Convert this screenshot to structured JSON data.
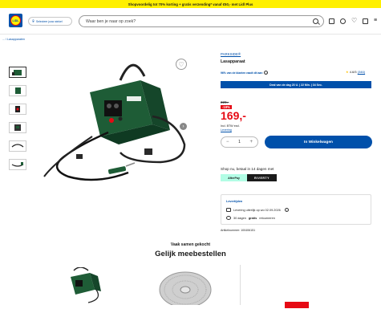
{
  "promo_banner": "Shopvoordelig tot 70% korting + gratis verzending* vanaf €50,- met Lidl Plus",
  "header": {
    "logo_text": "LIDL",
    "store_button": "Selecteer jouw winkel",
    "search_placeholder": "Waar ben je naar op zoek?"
  },
  "breadcrumb": "... / Lasapparaten",
  "gallery": {
    "thumb_count": 6
  },
  "product": {
    "brand": "PARKSIDE®",
    "title": "Lasapparaat",
    "recommend": "96% van de klanten raadt dit aan",
    "rating": "4.6/5",
    "reviews": "(346)",
    "deal_banner": "Deal van de dag 23 U. | 22 Min. | 34 Sec.",
    "old_price": "229,-",
    "discount": "-19%",
    "price": "169,-",
    "btw": "Incl. BTW excl.",
    "delivery_link": "Levering",
    "quantity": "1",
    "cart_button": "In Winkelwagen"
  },
  "payment": {
    "title": "Shop nu, betaal in 14 dagen met",
    "option1": "AfterPay",
    "option2": "RIVERTY"
  },
  "delivery": {
    "title": "Levertijden",
    "row1": "Levering uiterlijk op wo 02.09.2026",
    "row2_prefix": "30 dagen",
    "row2_bold": "gratis",
    "row2_suffix": "retourneren"
  },
  "article_number": "Artikelnummer: 100406151",
  "recommendations": {
    "subtitle": "Vaak samen gekocht",
    "title": "Gelijk meebestellen"
  },
  "colors": {
    "brand_blue": "#0050aa",
    "brand_yellow": "#fff000",
    "price_red": "#e60a14"
  }
}
